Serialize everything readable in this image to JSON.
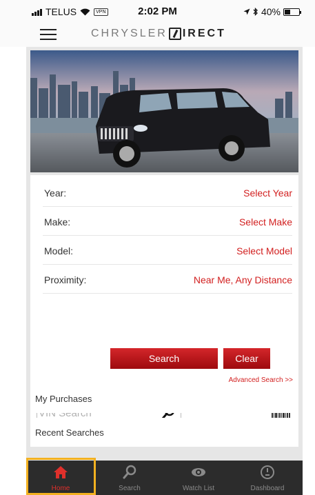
{
  "status_bar": {
    "carrier": "TELUS",
    "vpn": "VPN",
    "time": "2:02 PM",
    "battery": "40%",
    "battery_level": 0.4
  },
  "header": {
    "brand_left": "CHRYSLER",
    "brand_right": "IRECT"
  },
  "hero": {
    "icon": "vehicle-photo"
  },
  "search_form": {
    "rows": [
      {
        "label": "Year:",
        "value": "Select Year"
      },
      {
        "label": "Make:",
        "value": "Select Make"
      },
      {
        "label": "Model:",
        "value": "Select Model"
      },
      {
        "label": "Proximity:",
        "value": "Near Me, Any Distance"
      }
    ],
    "search_button": "Search",
    "clear_button": "Clear",
    "advanced_link": "Advanced Search >>"
  },
  "vin": {
    "placeholder": "VIN Search"
  },
  "lists": {
    "purchases": "My Purchases",
    "recent": "Recent Searches"
  },
  "tabbar": {
    "tabs": [
      {
        "label": "Home",
        "icon": "home-icon",
        "active": true
      },
      {
        "label": "Search",
        "icon": "search-icon",
        "active": false
      },
      {
        "label": "Watch List",
        "icon": "eye-icon",
        "active": false
      },
      {
        "label": "Dashboard",
        "icon": "speedometer-icon",
        "active": false
      }
    ]
  },
  "colors": {
    "accent": "#d21f1f",
    "tabbar_bg": "#2c2c2c",
    "highlight": "#f3b120"
  }
}
